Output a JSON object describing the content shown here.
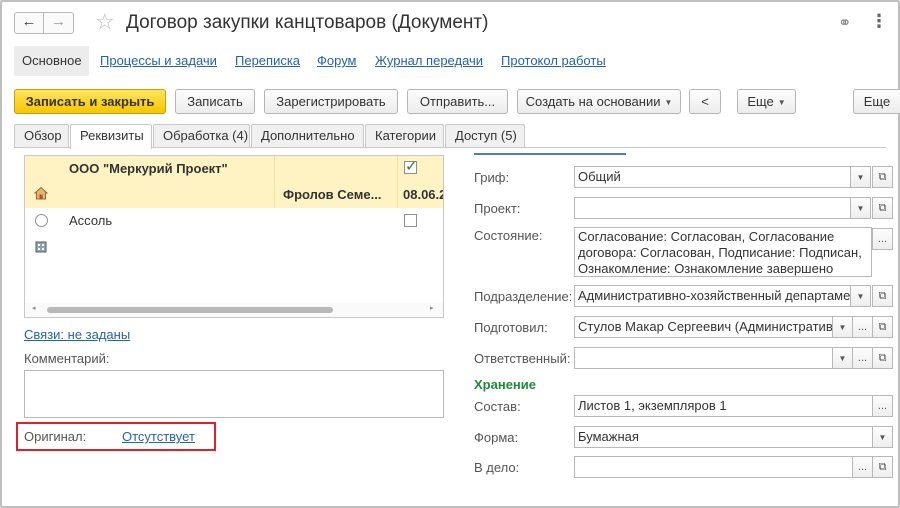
{
  "window": {
    "title": "Договор закупки канцтоваров (Документ)",
    "back_glyph": "←",
    "forward_glyph": "→",
    "star_glyph": "☆",
    "link_glyph": "⚭",
    "more_glyph": "⋮"
  },
  "sections": [
    "Основное",
    "Процессы и задачи",
    "Переписка",
    "Форум",
    "Журнал передачи",
    "Протокол работы"
  ],
  "commands": {
    "save_close": "Записать и закрыть",
    "save": "Записать",
    "register": "Зарегистрировать",
    "send": "Отправить...",
    "create_based": "Создать на основании",
    "share_glyph": "<",
    "more": "Еще",
    "more2": "Еще"
  },
  "tabs": [
    "Обзор",
    "Реквизиты",
    "Обработка (4)",
    "Дополнительно",
    "Категории",
    "Доступ (5)"
  ],
  "list": {
    "rows": [
      {
        "name": "ООО \"Меркурий Проект\"",
        "checked": true
      },
      {
        "person": "Фролов Семе...",
        "date": "08.06.2"
      },
      {
        "name": "Ассоль",
        "checked": false
      },
      {}
    ],
    "arrow_left": "◂",
    "arrow_right": "▸"
  },
  "links_label": "Связи: не заданы",
  "comment_label": "Комментарий:",
  "original": {
    "label": "Оригинал:",
    "value": "Отсутствует"
  },
  "form": {
    "grif": {
      "label": "Гриф:",
      "value": "Общий"
    },
    "project": {
      "label": "Проект:",
      "value": ""
    },
    "state": {
      "label": "Состояние:",
      "value": "Согласование: Согласован, Согласование договора: Согласован, Подписание: Подписан, Ознакомление: Ознакомление завершено"
    },
    "division": {
      "label": "Подразделение:",
      "value": "Административно-хозяйственный департамен"
    },
    "prepared": {
      "label": "Подготовил:",
      "value": "Стулов Макар Сергеевич (Административ"
    },
    "responsible": {
      "label": "Ответственный:",
      "value": ""
    },
    "storage_heading": "Хранение",
    "composition": {
      "label": "Состав:",
      "value": "Листов 1, экземпляров 1"
    },
    "form_type": {
      "label": "Форма:",
      "value": "Бумажная"
    },
    "to_case": {
      "label": "В дело:",
      "value": ""
    },
    "dots": "...",
    "open_glyph": "⧉",
    "dd_glyph": "▼"
  }
}
